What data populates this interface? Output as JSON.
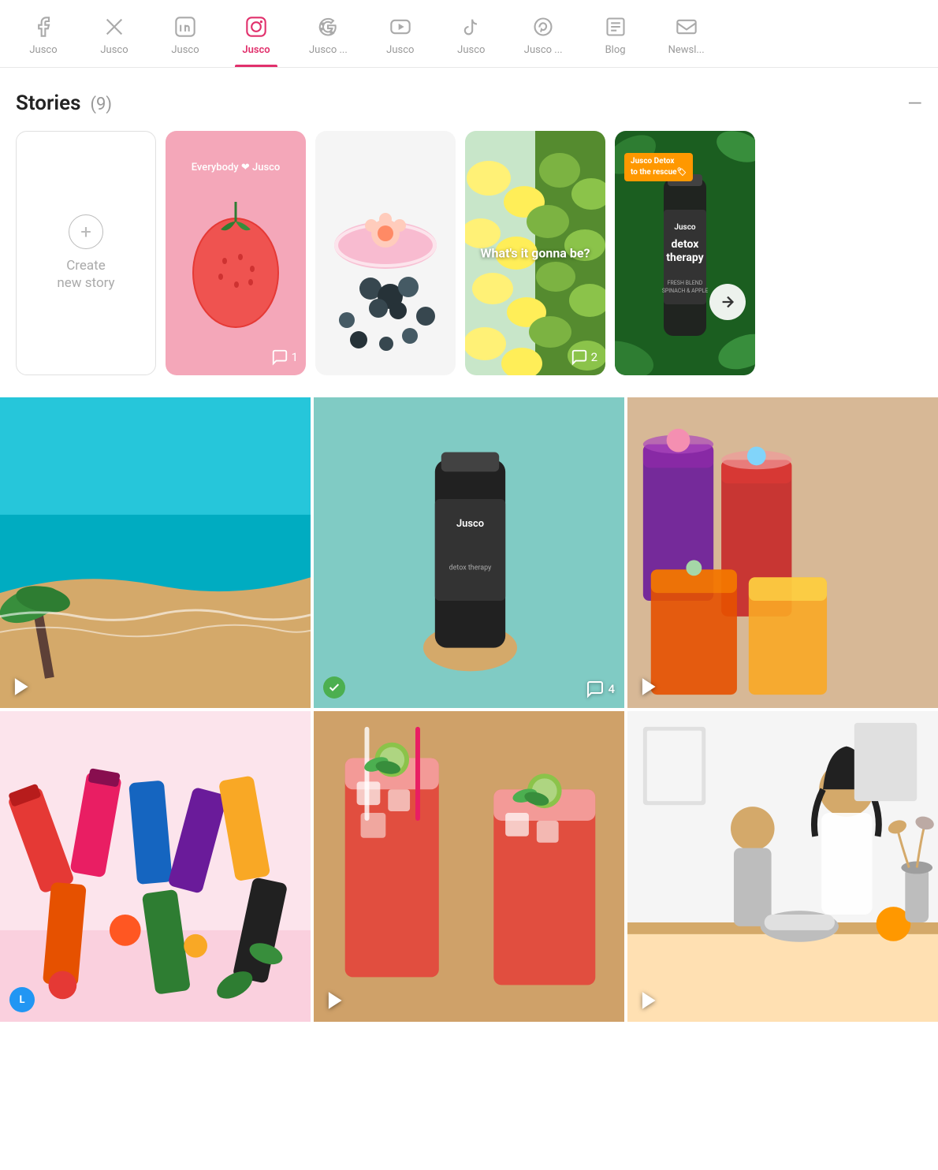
{
  "nav": {
    "tabs": [
      {
        "id": "facebook",
        "label": "Jusco",
        "icon": "facebook",
        "active": false
      },
      {
        "id": "twitter",
        "label": "Jusco",
        "icon": "twitter",
        "active": false
      },
      {
        "id": "linkedin",
        "label": "Jusco",
        "icon": "linkedin",
        "active": false
      },
      {
        "id": "instagram",
        "label": "Jusco",
        "icon": "instagram",
        "active": true
      },
      {
        "id": "google",
        "label": "Jusco ...",
        "icon": "google",
        "active": false
      },
      {
        "id": "youtube",
        "label": "Jusco",
        "icon": "youtube",
        "active": false
      },
      {
        "id": "tiktok",
        "label": "Jusco",
        "icon": "tiktok",
        "active": false
      },
      {
        "id": "pinterest",
        "label": "Jusco ...",
        "icon": "pinterest",
        "active": false
      },
      {
        "id": "blog",
        "label": "Blog",
        "icon": "blog",
        "active": false
      },
      {
        "id": "newsletter",
        "label": "Newsl...",
        "icon": "newsletter",
        "active": false
      }
    ]
  },
  "stories": {
    "title": "Stories",
    "count": "(9)",
    "collapse_icon": "—",
    "create_label": "Create\nnew story",
    "cards": [
      {
        "id": "create",
        "type": "create"
      },
      {
        "id": "story2",
        "type": "strawberry",
        "comments": "1",
        "top_text": "Everybody ❤ Jusco"
      },
      {
        "id": "story3",
        "type": "blueberry",
        "comments": ""
      },
      {
        "id": "story4",
        "type": "lemon",
        "comments": "2",
        "overlay_text": "What's it gonna be?"
      },
      {
        "id": "story5",
        "type": "detox",
        "label": "Jusco Detox\nto the rescue🏷",
        "has_arrow": true
      }
    ]
  },
  "grid": {
    "items": [
      {
        "id": "g1",
        "type": "beach",
        "has_play": true,
        "comment_count": "",
        "check": false
      },
      {
        "id": "g2",
        "type": "bottle_green",
        "has_play": false,
        "comment_count": "4",
        "check": true
      },
      {
        "id": "g3",
        "type": "drinks",
        "has_play": true,
        "comment_count": "",
        "check": false
      },
      {
        "id": "g4",
        "type": "bottles",
        "has_play": false,
        "comment_count": "",
        "check": false,
        "circle": "L"
      },
      {
        "id": "g5",
        "type": "cocktail",
        "has_play": true,
        "comment_count": "",
        "check": false
      },
      {
        "id": "g6",
        "type": "family",
        "has_play": true,
        "comment_count": "",
        "check": false
      }
    ]
  },
  "colors": {
    "active_tab": "#e1306c",
    "inactive_tab": "#999",
    "create_border": "#e0e0e0",
    "create_text": "#aaa"
  }
}
